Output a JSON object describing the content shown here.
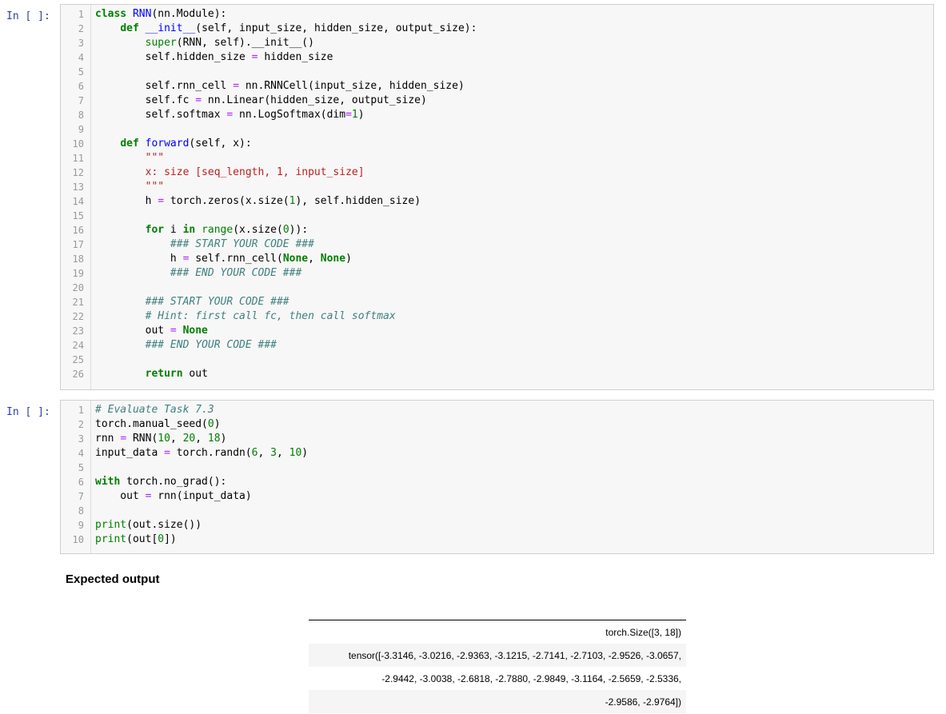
{
  "cells": [
    {
      "prompt": "In [ ]:",
      "lines": [
        {
          "n": "1",
          "html": "<span class=\"kw\">class</span> <span class=\"cl\">RNN</span>(nn.Module):"
        },
        {
          "n": "2",
          "html": "    <span class=\"kw\">def</span> <span class=\"fn\">__init__</span>(self, input_size, hidden_size, output_size):"
        },
        {
          "n": "3",
          "html": "        <span class=\"bi\">super</span>(RNN, self).__init__()"
        },
        {
          "n": "4",
          "html": "        self.hidden_size <span class=\"op\">=</span> hidden_size"
        },
        {
          "n": "5",
          "html": ""
        },
        {
          "n": "6",
          "html": "        self.rnn_cell <span class=\"op\">=</span> nn.RNNCell(input_size, hidden_size)"
        },
        {
          "n": "7",
          "html": "        self.fc <span class=\"op\">=</span> nn.Linear(hidden_size, output_size)"
        },
        {
          "n": "8",
          "html": "        self.softmax <span class=\"op\">=</span> nn.LogSoftmax(dim<span class=\"op\">=</span><span class=\"nm\">1</span>)"
        },
        {
          "n": "9",
          "html": ""
        },
        {
          "n": "10",
          "html": "    <span class=\"kw\">def</span> <span class=\"fn\">forward</span>(self, x):"
        },
        {
          "n": "11",
          "html": "        <span class=\"st\">\"\"\"</span>"
        },
        {
          "n": "12",
          "html": "<span class=\"st\">        x: size [seq_length, 1, input_size]</span>"
        },
        {
          "n": "13",
          "html": "<span class=\"st\">        \"\"\"</span>"
        },
        {
          "n": "14",
          "html": "        h <span class=\"op\">=</span> torch.zeros(x.size(<span class=\"nm\">1</span>), self.hidden_size)"
        },
        {
          "n": "15",
          "html": ""
        },
        {
          "n": "16",
          "html": "        <span class=\"kw\">for</span> i <span class=\"kw\">in</span> <span class=\"bi\">range</span>(x.size(<span class=\"nm\">0</span>)):"
        },
        {
          "n": "17",
          "html": "            <span class=\"cm\">### START YOUR CODE ###</span>"
        },
        {
          "n": "18",
          "html": "            h <span class=\"op\">=</span> self.rnn_cell(<span class=\"kw\">None</span>, <span class=\"kw\">None</span>)"
        },
        {
          "n": "19",
          "html": "            <span class=\"cm\">### END YOUR CODE ###</span>"
        },
        {
          "n": "20",
          "html": ""
        },
        {
          "n": "21",
          "html": "        <span class=\"cm\">### START YOUR CODE ###</span>"
        },
        {
          "n": "22",
          "html": "        <span class=\"cm\"># Hint: first call fc, then call softmax</span>"
        },
        {
          "n": "23",
          "html": "        out <span class=\"op\">=</span> <span class=\"kw\">None</span>"
        },
        {
          "n": "24",
          "html": "        <span class=\"cm\">### END YOUR CODE ###</span>"
        },
        {
          "n": "25",
          "html": ""
        },
        {
          "n": "26",
          "html": "        <span class=\"kw\">return</span> out"
        }
      ]
    },
    {
      "prompt": "In [ ]:",
      "lines": [
        {
          "n": "1",
          "html": "<span class=\"cm\"># Evaluate Task 7.3</span>"
        },
        {
          "n": "2",
          "html": "torch.manual_seed(<span class=\"nm\">0</span>)"
        },
        {
          "n": "3",
          "html": "rnn <span class=\"op\">=</span> RNN(<span class=\"nm\">10</span>, <span class=\"nm\">20</span>, <span class=\"nm\">18</span>)"
        },
        {
          "n": "4",
          "html": "input_data <span class=\"op\">=</span> torch.randn(<span class=\"nm\">6</span>, <span class=\"nm\">3</span>, <span class=\"nm\">10</span>)"
        },
        {
          "n": "5",
          "html": ""
        },
        {
          "n": "6",
          "html": "<span class=\"kw\">with</span> torch.no_grad():"
        },
        {
          "n": "7",
          "html": "    out <span class=\"op\">=</span> rnn(input_data)"
        },
        {
          "n": "8",
          "html": ""
        },
        {
          "n": "9",
          "html": "<span class=\"bi\">print</span>(out.size())"
        },
        {
          "n": "10",
          "html": "<span class=\"bi\">print</span>(out[<span class=\"nm\">0</span>])"
        }
      ]
    }
  ],
  "expected_output": {
    "heading": "Expected output",
    "rows": [
      "torch.Size([3, 18])",
      "tensor([-3.3146, -3.0216, -2.9363, -3.1215, -2.7141, -2.7103, -2.9526, -3.0657,",
      "-2.9442, -3.0038, -2.6818, -2.7880, -2.9849, -3.1164, -2.5659, -2.5336,",
      "-2.9586, -2.9764])"
    ]
  }
}
